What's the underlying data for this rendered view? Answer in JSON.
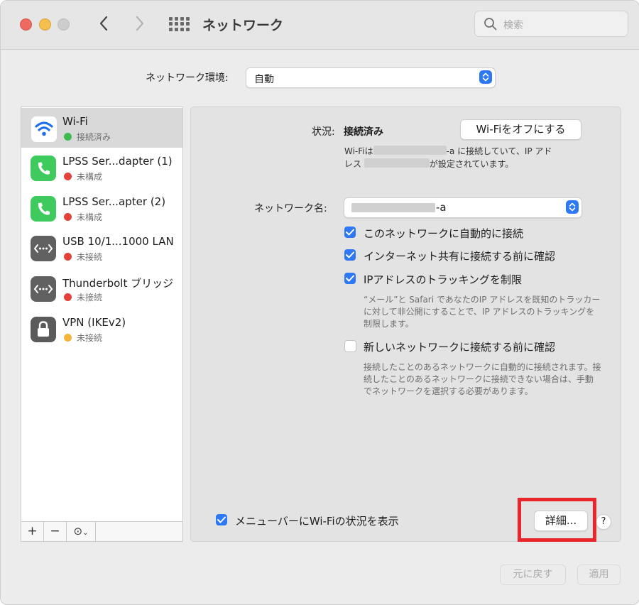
{
  "window": {
    "title": "ネットワーク",
    "search_placeholder": "検索"
  },
  "location": {
    "label": "ネットワーク環境:",
    "value": "自動"
  },
  "services": [
    {
      "name": "Wi-Fi",
      "status": "接続済み",
      "status_color": "#3dbb4e",
      "icon": "wifi-icon",
      "selected": true
    },
    {
      "name": "LPSS Ser...dapter (1)",
      "status": "未構成",
      "status_color": "#e5413a",
      "icon": "phone-icon"
    },
    {
      "name": "LPSS Ser...apter (2)",
      "status": "未構成",
      "status_color": "#e5413a",
      "icon": "phone-icon"
    },
    {
      "name": "USB 10/1...1000 LAN",
      "status": "未接続",
      "status_color": "#e5413a",
      "icon": "ethernet-icon"
    },
    {
      "name": "Thunderbolt ブリッジ",
      "status": "未接続",
      "status_color": "#e5413a",
      "icon": "ethernet-icon"
    },
    {
      "name": "VPN (IKEv2)",
      "status": "未接続",
      "status_color": "#f3b43a",
      "icon": "lock-icon"
    }
  ],
  "sidebar_toolbar": {
    "add": "+",
    "remove": "−",
    "action": "⊙"
  },
  "detail": {
    "status_label": "状況:",
    "status_value": "接続済み",
    "wifi_off_button": "Wi-Fiをオフにする",
    "status_desc_1a": "Wi-Fiは",
    "status_desc_1b": "-a に接続していて、IP アド",
    "status_desc_2a": "レス",
    "status_desc_2b": "が設定されています。",
    "network_name_label": "ネットワーク名:",
    "network_name_value": "-a",
    "checkboxes": [
      {
        "label": "このネットワークに自動的に接続",
        "checked": true
      },
      {
        "label": "インターネット共有に接続する前に確認",
        "checked": true
      },
      {
        "label": "IPアドレスのトラッキングを制限",
        "checked": true
      },
      {
        "label": "新しいネットワークに接続する前に確認",
        "checked": false
      }
    ],
    "tracking_note": "“メール”と Safari であなたのIP アドレスを既知のトラッカーに対して非公開にすることで、IP アドレスのトラッキングを制限します。",
    "new_network_note": "接続したことのあるネットワークに自動的に接続されます。接続したことのあるネットワークに接続できない場合は、手動でネットワークを選択する必要があります。",
    "menubar_checkbox": {
      "label": "メニューバーにWi-Fiの状況を表示",
      "checked": true
    },
    "advanced_button": "詳細...",
    "help_button": "?"
  },
  "footer": {
    "revert_button": "元に戻す",
    "apply_button": "適用"
  },
  "colors": {
    "accent": "#2d78f5",
    "highlight": "#e8262b"
  }
}
